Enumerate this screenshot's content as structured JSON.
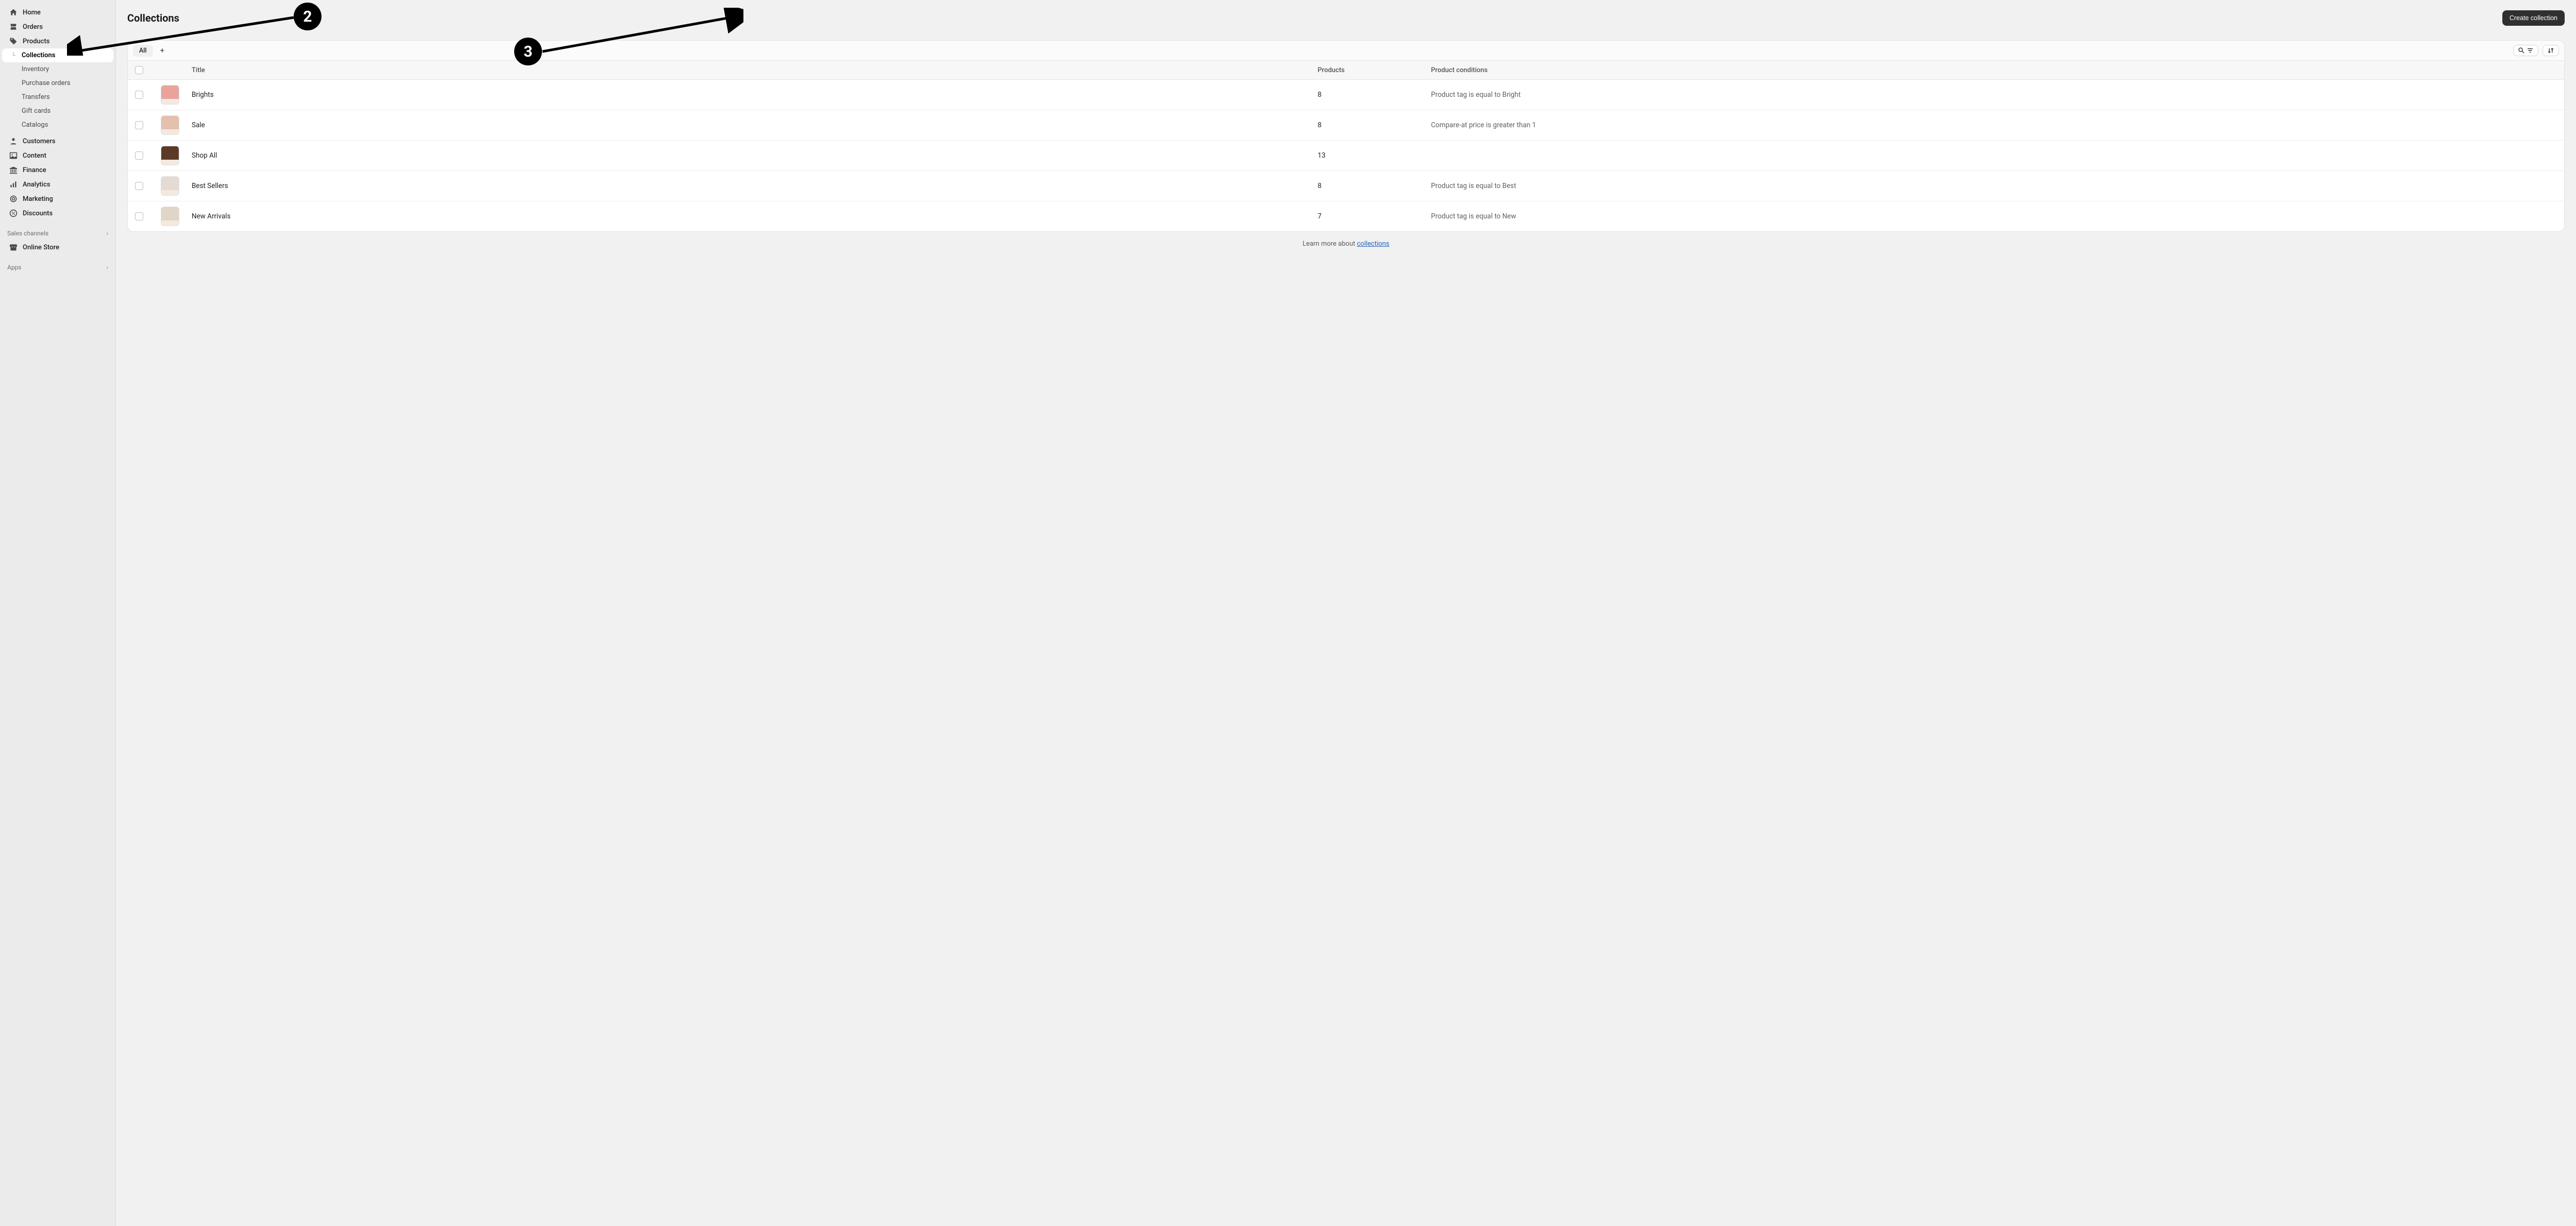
{
  "sidebar": {
    "home": "Home",
    "orders": "Orders",
    "products": "Products",
    "collections": "Collections",
    "inventory": "Inventory",
    "purchase_orders": "Purchase orders",
    "transfers": "Transfers",
    "gift_cards": "Gift cards",
    "catalogs": "Catalogs",
    "customers": "Customers",
    "content": "Content",
    "finance": "Finance",
    "analytics": "Analytics",
    "marketing": "Marketing",
    "discounts": "Discounts",
    "sales_channels_heading": "Sales channels",
    "online_store": "Online Store",
    "apps_heading": "Apps"
  },
  "header": {
    "title": "Collections",
    "create_button": "Create collection"
  },
  "tabs": {
    "all": "All"
  },
  "columns": {
    "title": "Title",
    "products": "Products",
    "conditions": "Product conditions"
  },
  "rows": [
    {
      "title": "Brights",
      "products": "8",
      "conditions": "Product tag is equal to Bright",
      "thumb_color": "#e9a39b"
    },
    {
      "title": "Sale",
      "products": "8",
      "conditions": "Compare-at price is greater than 1",
      "thumb_color": "#e3c1ad"
    },
    {
      "title": "Shop All",
      "products": "13",
      "conditions": "",
      "thumb_color": "#5b3b28"
    },
    {
      "title": "Best Sellers",
      "products": "8",
      "conditions": "Product tag is equal to Best",
      "thumb_color": "#e5dbd3"
    },
    {
      "title": "New Arrivals",
      "products": "7",
      "conditions": "Product tag is equal to New",
      "thumb_color": "#e1d5c8"
    }
  ],
  "footer": {
    "prefix": "Learn more about ",
    "link": "collections"
  },
  "annotations": {
    "b2": "2",
    "b3": "3"
  }
}
